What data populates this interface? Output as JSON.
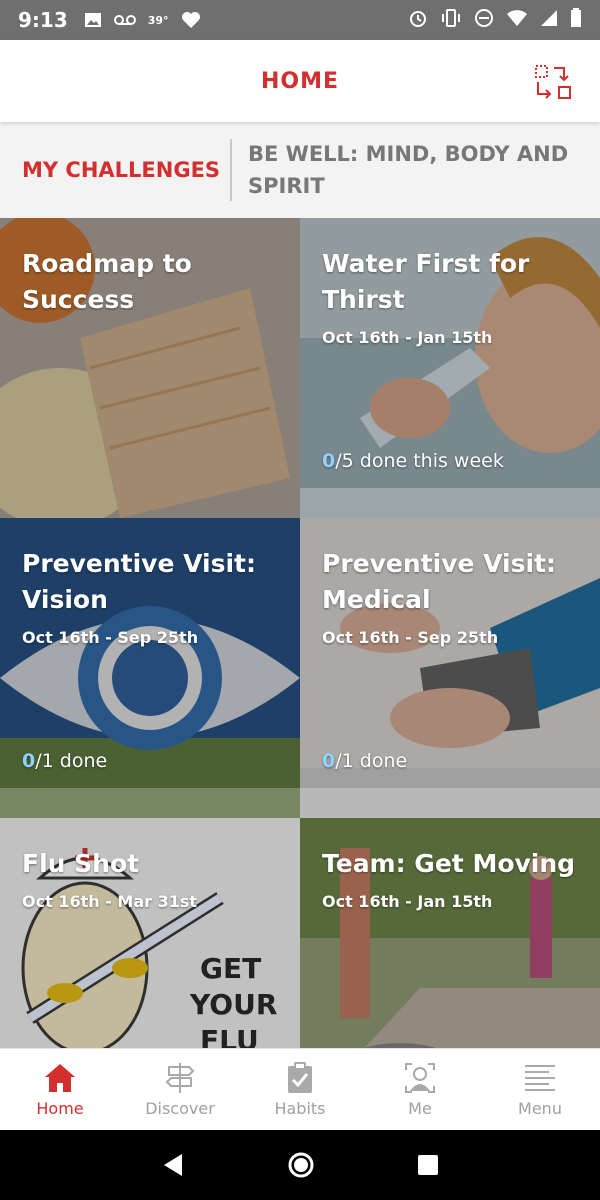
{
  "status_bar": {
    "time": "9:13",
    "temp": "39°",
    "icons": [
      "image-icon",
      "voicemail-icon",
      "heart-icon",
      "alarm-icon",
      "vibrate-icon",
      "dnd-icon",
      "wifi-icon",
      "signal-icon",
      "battery-icon"
    ]
  },
  "header": {
    "title": "HOME",
    "switch_icon": "switch-view-icon",
    "accent_color": "#d32f2f"
  },
  "tabs": [
    {
      "label": "MY CHALLENGES",
      "active": true
    },
    {
      "label": "BE WELL: MIND, BODY AND SPIRIT",
      "active": false
    }
  ],
  "tiles": [
    {
      "title": "Roadmap to Success",
      "date": "",
      "progress_done": "",
      "progress_rest": ""
    },
    {
      "title": "Water First for Thirst",
      "date": "Oct 16th - Jan 15th",
      "progress_done": "0",
      "progress_rest": "/5 done this week"
    },
    {
      "title": "Preventive Visit: Vision",
      "date": "Oct 16th - Sep 25th",
      "progress_done": "0",
      "progress_rest": "/1 done"
    },
    {
      "title": "Preventive Visit: Medical",
      "date": "Oct 16th - Sep 25th",
      "progress_done": "0",
      "progress_rest": "/1 done"
    },
    {
      "title": "Flu Shot",
      "date": "Oct 16th - Mar 31st",
      "progress_done": "",
      "progress_rest": "",
      "poster_text": "GET YOUR FLU"
    },
    {
      "title": "Team: Get Moving",
      "date": "Oct 16th - Jan 15th",
      "progress_done": "",
      "progress_rest": ""
    }
  ],
  "bottom_nav": [
    {
      "label": "Home",
      "icon": "home-icon",
      "active": true
    },
    {
      "label": "Discover",
      "icon": "signpost-icon",
      "active": false
    },
    {
      "label": "Habits",
      "icon": "clipboard-check-icon",
      "active": false
    },
    {
      "label": "Me",
      "icon": "profile-scan-icon",
      "active": false
    },
    {
      "label": "Menu",
      "icon": "menu-lines-icon",
      "active": false
    }
  ],
  "system_nav": [
    "back-icon",
    "home-circle-icon",
    "recents-icon"
  ]
}
